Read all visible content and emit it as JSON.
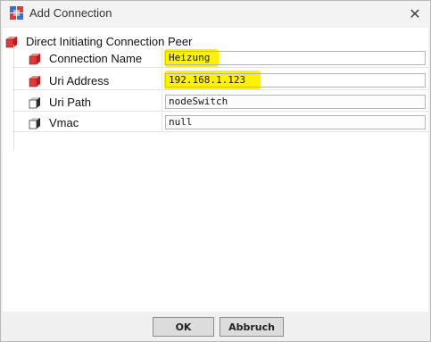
{
  "window": {
    "title": "Add Connection",
    "close_glyph": "✕",
    "app_icon": "app-grid-icon"
  },
  "group": {
    "label": "Direct Initiating Connection Peer",
    "icon": "red-cube-icon"
  },
  "properties": [
    {
      "label": "Connection Name",
      "value": "Heizung",
      "icon": "red-cube-icon",
      "highlighted": true
    },
    {
      "label": "Uri Address",
      "value": "192.168.1.123",
      "icon": "red-cube-icon",
      "highlighted": true
    },
    {
      "label": "Uri Path",
      "value": "nodeSwitch",
      "icon": "dark-cube-icon",
      "highlighted": false
    },
    {
      "label": "Vmac",
      "value": "null",
      "icon": "dark-cube-icon",
      "highlighted": false
    }
  ],
  "buttons": {
    "ok": "OK",
    "cancel": "Abbruch"
  },
  "colors": {
    "highlight": "#fff200",
    "red_cube": "#e23a3a",
    "dark_cube": "#3a3a3a"
  }
}
